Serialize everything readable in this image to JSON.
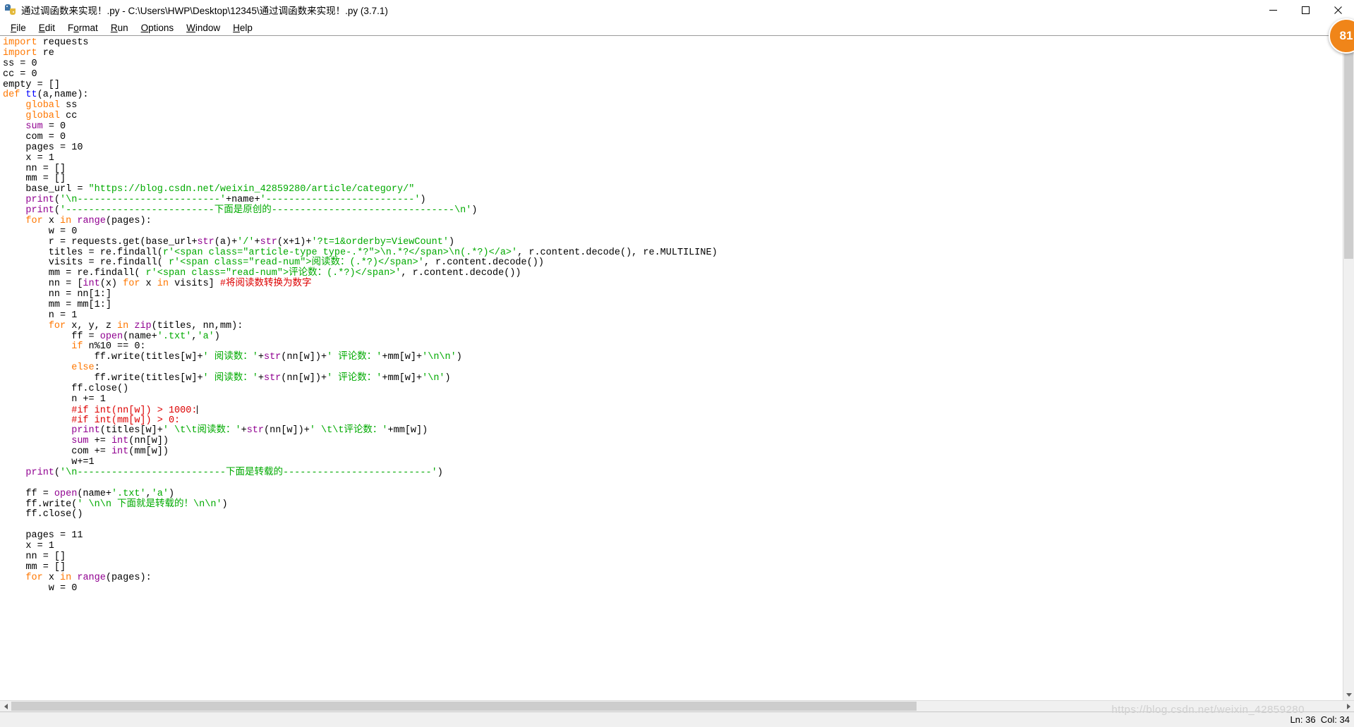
{
  "window": {
    "title": "通过调函数来实现！.py - C:\\Users\\HWP\\Desktop\\12345\\通过调函数来实现！.py (3.7.1)",
    "app_icon": "python-idle-icon",
    "minimize_label": "Minimize",
    "maximize_label": "Maximize",
    "close_label": "Close"
  },
  "menubar": {
    "items": [
      {
        "label": "File",
        "accel": "F"
      },
      {
        "label": "Edit",
        "accel": "E"
      },
      {
        "label": "Format",
        "accel": "o"
      },
      {
        "label": "Run",
        "accel": "R"
      },
      {
        "label": "Options",
        "accel": "O"
      },
      {
        "label": "Window",
        "accel": "W"
      },
      {
        "label": "Help",
        "accel": "H"
      }
    ]
  },
  "editor": {
    "language": "python",
    "file_name": "通过调函数来实现！.py",
    "python_version": "3.7.1",
    "lines": [
      [
        {
          "t": "import",
          "c": "kw"
        },
        {
          "t": " requests",
          "c": "plain"
        }
      ],
      [
        {
          "t": "import",
          "c": "kw"
        },
        {
          "t": " re",
          "c": "plain"
        }
      ],
      [
        {
          "t": "ss = 0",
          "c": "plain"
        }
      ],
      [
        {
          "t": "cc = 0",
          "c": "plain"
        }
      ],
      [
        {
          "t": "empty = []",
          "c": "plain"
        }
      ],
      [
        {
          "t": "def",
          "c": "kw"
        },
        {
          "t": " ",
          "c": "plain"
        },
        {
          "t": "tt",
          "c": "def"
        },
        {
          "t": "(a,name):",
          "c": "plain"
        }
      ],
      [
        {
          "t": "    ",
          "c": "plain"
        },
        {
          "t": "global",
          "c": "kw"
        },
        {
          "t": " ss",
          "c": "plain"
        }
      ],
      [
        {
          "t": "    ",
          "c": "plain"
        },
        {
          "t": "global",
          "c": "kw"
        },
        {
          "t": " cc",
          "c": "plain"
        }
      ],
      [
        {
          "t": "    ",
          "c": "plain"
        },
        {
          "t": "sum",
          "c": "bi"
        },
        {
          "t": " = 0",
          "c": "plain"
        }
      ],
      [
        {
          "t": "    com = 0",
          "c": "plain"
        }
      ],
      [
        {
          "t": "    pages = 10",
          "c": "plain"
        }
      ],
      [
        {
          "t": "    x = 1",
          "c": "plain"
        }
      ],
      [
        {
          "t": "    nn = []",
          "c": "plain"
        }
      ],
      [
        {
          "t": "    mm = []",
          "c": "plain"
        }
      ],
      [
        {
          "t": "    base_url = ",
          "c": "plain"
        },
        {
          "t": "\"https://blog.csdn.net/weixin_42859280/article/category/\"",
          "c": "str"
        }
      ],
      [
        {
          "t": "    ",
          "c": "plain"
        },
        {
          "t": "print",
          "c": "bi"
        },
        {
          "t": "(",
          "c": "plain"
        },
        {
          "t": "'\\n-------------------------'",
          "c": "str"
        },
        {
          "t": "+name+",
          "c": "plain"
        },
        {
          "t": "'--------------------------'",
          "c": "str"
        },
        {
          "t": ")",
          "c": "plain"
        }
      ],
      [
        {
          "t": "    ",
          "c": "plain"
        },
        {
          "t": "print",
          "c": "bi"
        },
        {
          "t": "(",
          "c": "plain"
        },
        {
          "t": "'--------------------------下面是原创的--------------------------------\\n'",
          "c": "str"
        },
        {
          "t": ")",
          "c": "plain"
        }
      ],
      [
        {
          "t": "    ",
          "c": "plain"
        },
        {
          "t": "for",
          "c": "kw"
        },
        {
          "t": " x ",
          "c": "plain"
        },
        {
          "t": "in",
          "c": "kw"
        },
        {
          "t": " ",
          "c": "plain"
        },
        {
          "t": "range",
          "c": "bi"
        },
        {
          "t": "(pages):",
          "c": "plain"
        }
      ],
      [
        {
          "t": "        w = 0",
          "c": "plain"
        }
      ],
      [
        {
          "t": "        r = requests.get(base_url+",
          "c": "plain"
        },
        {
          "t": "str",
          "c": "bi"
        },
        {
          "t": "(a)+",
          "c": "plain"
        },
        {
          "t": "'/'",
          "c": "str"
        },
        {
          "t": "+",
          "c": "plain"
        },
        {
          "t": "str",
          "c": "bi"
        },
        {
          "t": "(x+1)+",
          "c": "plain"
        },
        {
          "t": "'?t=1&orderby=ViewCount'",
          "c": "str"
        },
        {
          "t": ")",
          "c": "plain"
        }
      ],
      [
        {
          "t": "        titles = re.findall(",
          "c": "plain"
        },
        {
          "t": "r'<span class=\"article-type type-.*?\">\\n.*?</span>\\n(.*?)</a>'",
          "c": "str"
        },
        {
          "t": ", r.content.decode(), re.MULTILINE)",
          "c": "plain"
        }
      ],
      [
        {
          "t": "        visits = re.findall( ",
          "c": "plain"
        },
        {
          "t": "r'<span class=\"read-num\">阅读数：(.*?)</span>'",
          "c": "str"
        },
        {
          "t": ", r.content.decode())",
          "c": "plain"
        }
      ],
      [
        {
          "t": "        mm = re.findall( ",
          "c": "plain"
        },
        {
          "t": "r'<span class=\"read-num\">评论数：(.*?)</span>'",
          "c": "str"
        },
        {
          "t": ", r.content.decode())",
          "c": "plain"
        }
      ],
      [
        {
          "t": "        nn = [",
          "c": "plain"
        },
        {
          "t": "int",
          "c": "bi"
        },
        {
          "t": "(x) ",
          "c": "plain"
        },
        {
          "t": "for",
          "c": "kw"
        },
        {
          "t": " x ",
          "c": "plain"
        },
        {
          "t": "in",
          "c": "kw"
        },
        {
          "t": " visits] ",
          "c": "plain"
        },
        {
          "t": "#将阅读数转换为数字",
          "c": "cmt"
        }
      ],
      [
        {
          "t": "        nn = nn[1:]",
          "c": "plain"
        }
      ],
      [
        {
          "t": "        mm = mm[1:]",
          "c": "plain"
        }
      ],
      [
        {
          "t": "        n = 1",
          "c": "plain"
        }
      ],
      [
        {
          "t": "        ",
          "c": "plain"
        },
        {
          "t": "for",
          "c": "kw"
        },
        {
          "t": " x, y, z ",
          "c": "plain"
        },
        {
          "t": "in",
          "c": "kw"
        },
        {
          "t": " ",
          "c": "plain"
        },
        {
          "t": "zip",
          "c": "bi"
        },
        {
          "t": "(titles, nn,mm):",
          "c": "plain"
        }
      ],
      [
        {
          "t": "            ff = ",
          "c": "plain"
        },
        {
          "t": "open",
          "c": "bi"
        },
        {
          "t": "(name+",
          "c": "plain"
        },
        {
          "t": "'.txt'",
          "c": "str"
        },
        {
          "t": ",",
          "c": "plain"
        },
        {
          "t": "'a'",
          "c": "str"
        },
        {
          "t": ")",
          "c": "plain"
        }
      ],
      [
        {
          "t": "            ",
          "c": "plain"
        },
        {
          "t": "if",
          "c": "kw"
        },
        {
          "t": " n%10 == 0:",
          "c": "plain"
        }
      ],
      [
        {
          "t": "                ff.write(titles[w]+",
          "c": "plain"
        },
        {
          "t": "' 阅读数：'",
          "c": "str"
        },
        {
          "t": "+",
          "c": "plain"
        },
        {
          "t": "str",
          "c": "bi"
        },
        {
          "t": "(nn[w])+",
          "c": "plain"
        },
        {
          "t": "' 评论数：'",
          "c": "str"
        },
        {
          "t": "+mm[w]+",
          "c": "plain"
        },
        {
          "t": "'\\n\\n'",
          "c": "str"
        },
        {
          "t": ")",
          "c": "plain"
        }
      ],
      [
        {
          "t": "            ",
          "c": "plain"
        },
        {
          "t": "else",
          "c": "kw"
        },
        {
          "t": ":",
          "c": "plain"
        }
      ],
      [
        {
          "t": "                ff.write(titles[w]+",
          "c": "plain"
        },
        {
          "t": "' 阅读数：'",
          "c": "str"
        },
        {
          "t": "+",
          "c": "plain"
        },
        {
          "t": "str",
          "c": "bi"
        },
        {
          "t": "(nn[w])+",
          "c": "plain"
        },
        {
          "t": "' 评论数：'",
          "c": "str"
        },
        {
          "t": "+mm[w]+",
          "c": "plain"
        },
        {
          "t": "'\\n'",
          "c": "str"
        },
        {
          "t": ")",
          "c": "plain"
        }
      ],
      [
        {
          "t": "            ff.close()",
          "c": "plain"
        }
      ],
      [
        {
          "t": "            n += 1",
          "c": "plain"
        }
      ],
      [
        {
          "t": "            ",
          "c": "plain"
        },
        {
          "t": "#if int(nn[w]) > 1000:",
          "c": "cmt"
        },
        {
          "t": "|CARET|",
          "c": "caret"
        }
      ],
      [
        {
          "t": "            ",
          "c": "plain"
        },
        {
          "t": "#if int(mm[w]) > 0:",
          "c": "cmt"
        }
      ],
      [
        {
          "t": "            ",
          "c": "plain"
        },
        {
          "t": "print",
          "c": "bi"
        },
        {
          "t": "(titles[w]+",
          "c": "plain"
        },
        {
          "t": "' \\t\\t阅读数：'",
          "c": "str"
        },
        {
          "t": "+",
          "c": "plain"
        },
        {
          "t": "str",
          "c": "bi"
        },
        {
          "t": "(nn[w])+",
          "c": "plain"
        },
        {
          "t": "' \\t\\t评论数：'",
          "c": "str"
        },
        {
          "t": "+mm[w])",
          "c": "plain"
        }
      ],
      [
        {
          "t": "            ",
          "c": "plain"
        },
        {
          "t": "sum",
          "c": "bi"
        },
        {
          "t": " += ",
          "c": "plain"
        },
        {
          "t": "int",
          "c": "bi"
        },
        {
          "t": "(nn[w])",
          "c": "plain"
        }
      ],
      [
        {
          "t": "            com += ",
          "c": "plain"
        },
        {
          "t": "int",
          "c": "bi"
        },
        {
          "t": "(mm[w])",
          "c": "plain"
        }
      ],
      [
        {
          "t": "            w+=1",
          "c": "plain"
        }
      ],
      [
        {
          "t": "    ",
          "c": "plain"
        },
        {
          "t": "print",
          "c": "bi"
        },
        {
          "t": "(",
          "c": "plain"
        },
        {
          "t": "'\\n--------------------------下面是转载的--------------------------'",
          "c": "str"
        },
        {
          "t": ")",
          "c": "plain"
        }
      ],
      [
        {
          "t": "",
          "c": "plain"
        }
      ],
      [
        {
          "t": "    ff = ",
          "c": "plain"
        },
        {
          "t": "open",
          "c": "bi"
        },
        {
          "t": "(name+",
          "c": "plain"
        },
        {
          "t": "'.txt'",
          "c": "str"
        },
        {
          "t": ",",
          "c": "plain"
        },
        {
          "t": "'a'",
          "c": "str"
        },
        {
          "t": ")",
          "c": "plain"
        }
      ],
      [
        {
          "t": "    ff.write(",
          "c": "plain"
        },
        {
          "t": "' \\n\\n 下面就是转载的！\\n\\n'",
          "c": "str"
        },
        {
          "t": ")",
          "c": "plain"
        }
      ],
      [
        {
          "t": "    ff.close()",
          "c": "plain"
        }
      ],
      [
        {
          "t": "",
          "c": "plain"
        }
      ],
      [
        {
          "t": "    pages = 11",
          "c": "plain"
        }
      ],
      [
        {
          "t": "    x = 1",
          "c": "plain"
        }
      ],
      [
        {
          "t": "    nn = []",
          "c": "plain"
        }
      ],
      [
        {
          "t": "    mm = []",
          "c": "plain"
        }
      ],
      [
        {
          "t": "    ",
          "c": "plain"
        },
        {
          "t": "for",
          "c": "kw"
        },
        {
          "t": " x ",
          "c": "plain"
        },
        {
          "t": "in",
          "c": "kw"
        },
        {
          "t": " ",
          "c": "plain"
        },
        {
          "t": "range",
          "c": "bi"
        },
        {
          "t": "(pages):",
          "c": "plain"
        }
      ],
      [
        {
          "t": "        w = 0",
          "c": "plain"
        }
      ]
    ]
  },
  "scrollbars": {
    "vertical": {
      "up_icon": "arrow-up-icon",
      "down_icon": "arrow-down-icon",
      "thumb_size_pct": 33,
      "thumb_pos_pct": 0
    },
    "horizontal": {
      "left_icon": "arrow-left-icon",
      "right_icon": "arrow-right-icon",
      "thumb_size_pct": 68,
      "thumb_pos_pct": 0
    }
  },
  "statusbar": {
    "position": "Ln: 36  Col: 34",
    "line": 36,
    "column": 34
  },
  "watermark": {
    "text": "https://blog.csdn.net/weixin_42859280"
  },
  "float_badge": {
    "text": "81",
    "color": "#f08519"
  },
  "colors": {
    "keyword": "#ff7700",
    "builtin": "#900090",
    "definition": "#0000ff",
    "string": "#00aa00",
    "comment": "#dd0000",
    "text": "#000000",
    "background": "#ffffff",
    "chrome": "#f0f0f0"
  }
}
